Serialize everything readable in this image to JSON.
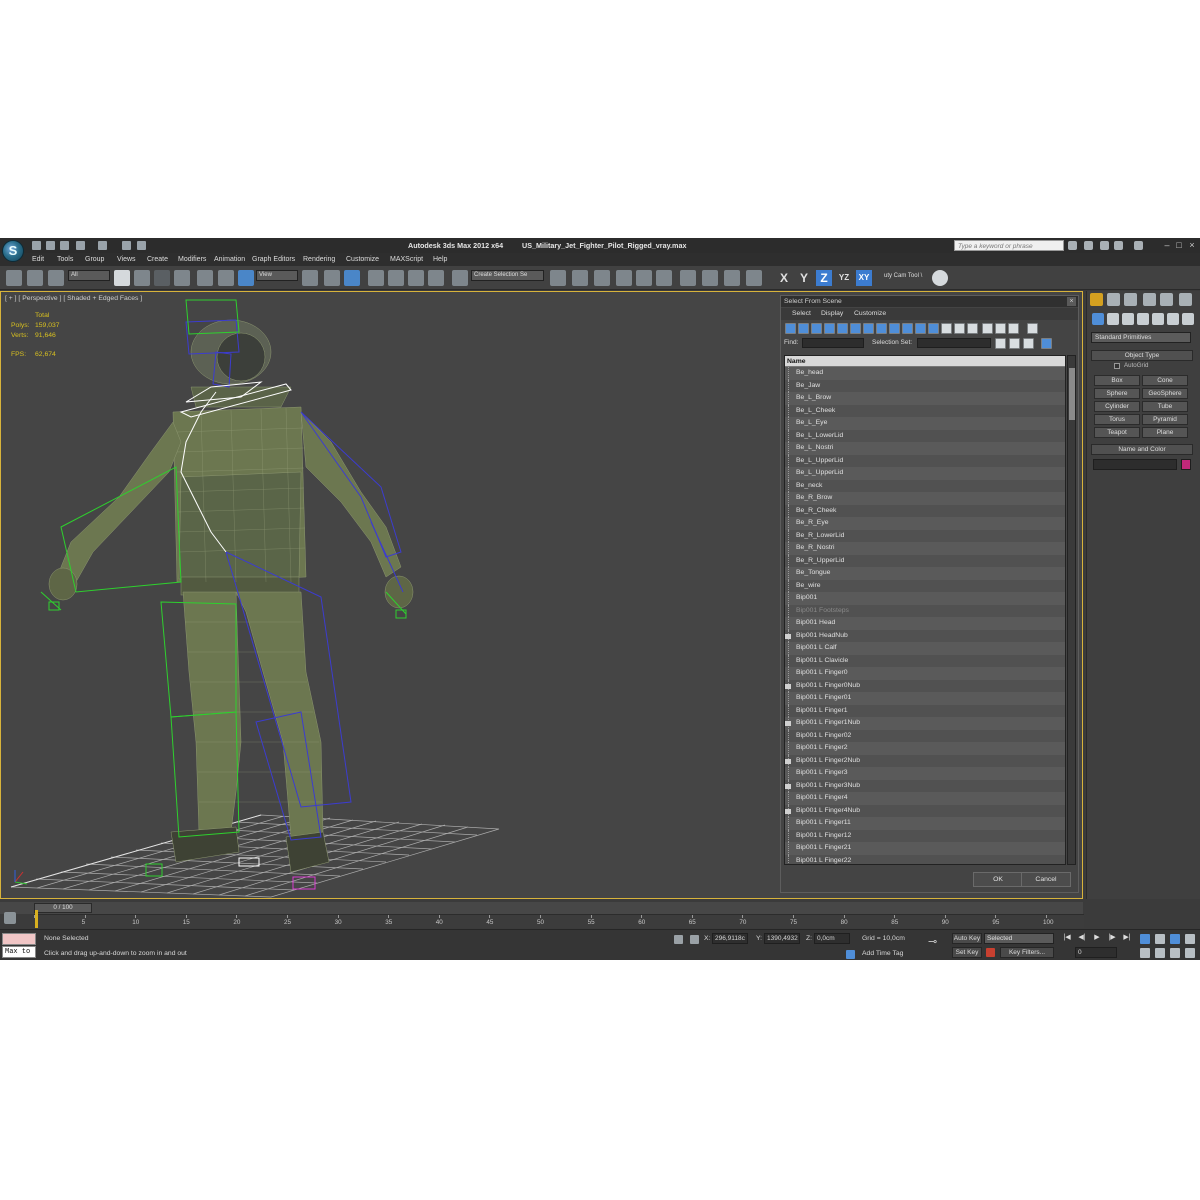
{
  "titlebar": {
    "app_title": "Autodesk 3ds Max  2012 x64",
    "file_title": "US_Military_Jet_Fighter_Pilot_Rigged_vray.max",
    "search_placeholder": "Type a keyword or phrase"
  },
  "menu": [
    "Edit",
    "Tools",
    "Group",
    "Views",
    "Create",
    "Modifiers",
    "Animation",
    "Graph Editors",
    "Rendering",
    "Customize",
    "MAXScript",
    "Help"
  ],
  "toolbar": {
    "selection_filter": "All",
    "reference_coord": "View",
    "named_selection": "Create Selection Se",
    "axis_x": "X",
    "axis_y": "Y",
    "axis_z": "Z",
    "axis_yz": "YZ",
    "axis_xy": "XY",
    "camtool_label": "uty Cam Tool \\"
  },
  "viewport": {
    "label": "[ + ] [ Perspective ] [ Shaded + Edged Faces ]",
    "stats": {
      "total_label": "Total",
      "polys_label": "Polys:",
      "polys_value": "159,037",
      "verts_label": "Verts:",
      "verts_value": "91,646",
      "fps_label": "FPS:",
      "fps_value": "62,674"
    }
  },
  "dialog": {
    "title": "Select From Scene",
    "menu": [
      "Select",
      "Display",
      "Customize"
    ],
    "find_label": "Find:",
    "selection_set_label": "Selection Set:",
    "column_header": "Name",
    "ok_label": "OK",
    "cancel_label": "Cancel",
    "rows": [
      {
        "name": "Be_head",
        "dim": false,
        "icon": false
      },
      {
        "name": "Be_Jaw",
        "dim": false,
        "icon": false
      },
      {
        "name": "Be_L_Brow",
        "dim": false,
        "icon": false
      },
      {
        "name": "Be_L_Cheek",
        "dim": false,
        "icon": false
      },
      {
        "name": "Be_L_Eye",
        "dim": false,
        "icon": false
      },
      {
        "name": "Be_L_LowerLid",
        "dim": false,
        "icon": false
      },
      {
        "name": "Be_L_Nostri",
        "dim": false,
        "icon": false
      },
      {
        "name": "Be_L_UpperLid",
        "dim": false,
        "icon": false
      },
      {
        "name": "Be_L_UpperLid",
        "dim": false,
        "icon": false
      },
      {
        "name": "Be_neck",
        "dim": false,
        "icon": false
      },
      {
        "name": "Be_R_Brow",
        "dim": false,
        "icon": false
      },
      {
        "name": "Be_R_Cheek",
        "dim": false,
        "icon": false
      },
      {
        "name": "Be_R_Eye",
        "dim": false,
        "icon": false
      },
      {
        "name": "Be_R_LowerLid",
        "dim": false,
        "icon": false
      },
      {
        "name": "Be_R_Nostri",
        "dim": false,
        "icon": false
      },
      {
        "name": "Be_R_UpperLid",
        "dim": false,
        "icon": false
      },
      {
        "name": "Be_Tongue",
        "dim": false,
        "icon": false
      },
      {
        "name": "Be_wire",
        "dim": false,
        "icon": false
      },
      {
        "name": "Bip001",
        "dim": false,
        "icon": false
      },
      {
        "name": "Bip001 Footsteps",
        "dim": true,
        "icon": false
      },
      {
        "name": "Bip001 Head",
        "dim": false,
        "icon": false
      },
      {
        "name": "Bip001 HeadNub",
        "dim": false,
        "icon": true
      },
      {
        "name": "Bip001 L Calf",
        "dim": false,
        "icon": false
      },
      {
        "name": "Bip001 L Clavicle",
        "dim": false,
        "icon": false
      },
      {
        "name": "Bip001 L Finger0",
        "dim": false,
        "icon": false
      },
      {
        "name": "Bip001 L Finger0Nub",
        "dim": false,
        "icon": true
      },
      {
        "name": "Bip001 L Finger01",
        "dim": false,
        "icon": false
      },
      {
        "name": "Bip001 L Finger1",
        "dim": false,
        "icon": false
      },
      {
        "name": "Bip001 L Finger1Nub",
        "dim": false,
        "icon": true
      },
      {
        "name": "Bip001 L Finger02",
        "dim": false,
        "icon": false
      },
      {
        "name": "Bip001 L Finger2",
        "dim": false,
        "icon": false
      },
      {
        "name": "Bip001 L Finger2Nub",
        "dim": false,
        "icon": true
      },
      {
        "name": "Bip001 L Finger3",
        "dim": false,
        "icon": false
      },
      {
        "name": "Bip001 L Finger3Nub",
        "dim": false,
        "icon": true
      },
      {
        "name": "Bip001 L Finger4",
        "dim": false,
        "icon": false
      },
      {
        "name": "Bip001 L Finger4Nub",
        "dim": false,
        "icon": true
      },
      {
        "name": "Bip001 L Finger11",
        "dim": false,
        "icon": false
      },
      {
        "name": "Bip001 L Finger12",
        "dim": false,
        "icon": false
      },
      {
        "name": "Bip001 L Finger21",
        "dim": false,
        "icon": false
      },
      {
        "name": "Bip001 L Finger22",
        "dim": false,
        "icon": false
      },
      {
        "name": "Bip001 L Finger31",
        "dim": false,
        "icon": false
      }
    ]
  },
  "command_panel": {
    "category": "Standard Primitives",
    "object_type_header": "Object Type",
    "autogrid_label": "AutoGrid",
    "buttons": [
      "Box",
      "Cone",
      "Sphere",
      "GeoSphere",
      "Cylinder",
      "Tube",
      "Torus",
      "Pyramid",
      "Teapot",
      "Plane"
    ],
    "name_color_header": "Name and Color"
  },
  "timeline": {
    "slider_label": "0 / 100",
    "ticks": [
      "0",
      "5",
      "10",
      "15",
      "20",
      "25",
      "30",
      "35",
      "40",
      "45",
      "50",
      "55",
      "60",
      "65",
      "70",
      "75",
      "80",
      "85",
      "90",
      "95",
      "100"
    ]
  },
  "statusbar": {
    "maxscript_output": "Max to",
    "selection_status": "None Selected",
    "prompt": "Click and drag up-and-down to zoom in and out",
    "x_label": "X:",
    "x_value": "296,9118c",
    "y_label": "Y:",
    "y_value": "1390,4932",
    "z_label": "Z:",
    "z_value": "0,0cm",
    "grid_text": "Grid = 10,0cm",
    "add_time_tag": "Add Time Tag",
    "auto_key": "Auto Key",
    "set_key": "Set Key",
    "key_mode": "Selected",
    "key_filters": "Key Filters...",
    "frame_value": "0"
  },
  "colors": {
    "viewport_border": "#d7b33b",
    "stats_text": "#d8c020",
    "active_axis": "#3c7cd0",
    "mesh": "#6c7750",
    "bone": "#3c3ccf",
    "helper_green": "#2ed02e",
    "swatch": "#c1287a"
  }
}
